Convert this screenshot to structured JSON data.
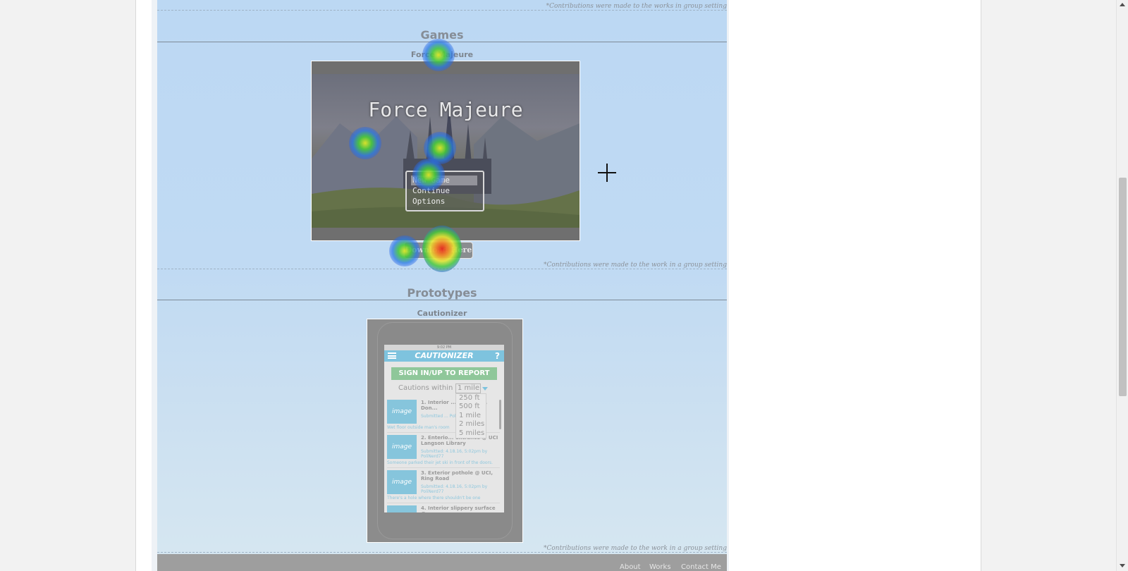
{
  "credits": {
    "top": "*Contributions were made to the works in group setting",
    "games": "*Contributions were made to the work in a group setting",
    "prototypes": "*Contributions were made to the work in a group setting"
  },
  "sections": {
    "games": {
      "title": "Games",
      "item": {
        "title": "Force Majeure",
        "screenshot": {
          "game_title": "Force Majeure",
          "menu": [
            "New Game",
            "Continue",
            "Options"
          ],
          "selected_menu_item": "New Game"
        },
        "download_label": "Download Here"
      }
    },
    "prototypes": {
      "title": "Prototypes",
      "item": {
        "title": "Cautionizer",
        "screenshot": {
          "status_bar": "9:02 PM",
          "app_title": "CAUTIONIZER",
          "help": "?",
          "signin_label": "SIGN IN/UP TO REPORT",
          "cautions_within_label": "Cautions within",
          "selected_distance": "1 mile",
          "distance_options": [
            "250 ft",
            "500 ft",
            "1 mile",
            "2 miles",
            "5 miles"
          ],
          "thumb_label": "image",
          "reports": [
            {
              "title": "1. Interior ... ace @ UCI, Don...",
              "meta": "Submitted ... PoliNerd77",
              "desc": "Wet floor outside man's room"
            },
            {
              "title": "2. Enterio... entrance @ UCI Langson Library",
              "meta": "Submitted: 4.18.16, 5:02pm by PoliNerd77",
              "desc": "Someone parked their jet ski in front of the doors."
            },
            {
              "title": "3. Exterior pothole @ UCI, Ring Road",
              "meta": "Submitted: 4.18.16, 5:02pm by PoliNerd77",
              "desc": "There's a hole where there shouldn't be one"
            },
            {
              "title": "4. Interior slippery surface @",
              "meta": "",
              "desc": ""
            }
          ]
        }
      }
    }
  },
  "footer": {
    "links": [
      "About",
      "Works",
      "Contact Me"
    ]
  },
  "heatmap": {
    "clicks": [
      {
        "target": "force-majeure-title",
        "intensity": "medium"
      },
      {
        "target": "game-screenshot-left",
        "intensity": "medium"
      },
      {
        "target": "game-screenshot-center",
        "intensity": "medium"
      },
      {
        "target": "game-menu",
        "intensity": "medium"
      },
      {
        "target": "download-button-left",
        "intensity": "low"
      },
      {
        "target": "download-button",
        "intensity": "high"
      }
    ]
  },
  "colors": {
    "content_background": "#bcd8f3",
    "footer_background": "#9e9e9e",
    "cautionizer_accent": "#7ec3de",
    "cautionizer_signin": "#8fc79a"
  }
}
